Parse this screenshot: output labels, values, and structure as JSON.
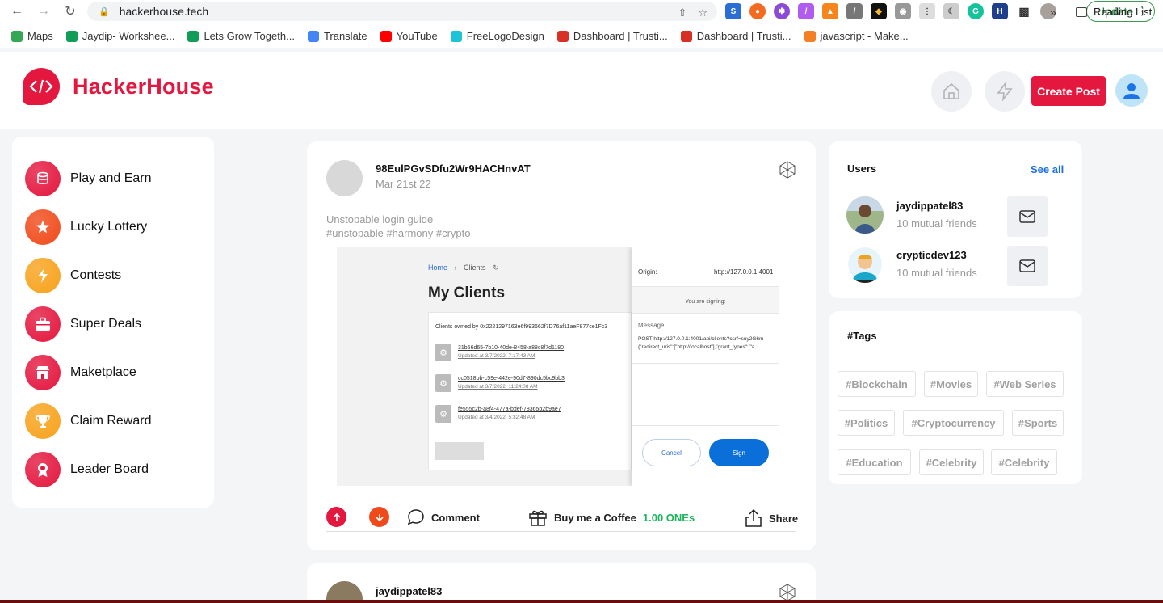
{
  "browser": {
    "url": "hackerhouse.tech",
    "update_label": "Update",
    "reading_list": "Reading List",
    "bookmarks": [
      {
        "label": "Maps",
        "color": "#34a853"
      },
      {
        "label": "Jaydip- Workshee...",
        "color": "#0f9d58"
      },
      {
        "label": "Lets Grow Togeth...",
        "color": "#0f9d58"
      },
      {
        "label": "Translate",
        "color": "#4285f4"
      },
      {
        "label": "YouTube",
        "color": "#ff0000"
      },
      {
        "label": "FreeLogoDesign",
        "color": "#1ec3d7"
      },
      {
        "label": "Dashboard | Trusti...",
        "color": "#d93025"
      },
      {
        "label": "Dashboard | Trusti...",
        "color": "#d93025"
      },
      {
        "label": "javascript - Make...",
        "color": "#f48024"
      }
    ]
  },
  "header": {
    "brand": "HackerHouse",
    "create_post": "Create Post"
  },
  "sidebar": {
    "items": [
      {
        "label": "Play and Earn",
        "icon": "coins-icon",
        "color": "#e4173f"
      },
      {
        "label": "Lucky Lottery",
        "icon": "star-icon",
        "color": "#f04a1a"
      },
      {
        "label": "Contests",
        "icon": "lightning-icon",
        "color": "#f7a21b"
      },
      {
        "label": "Super Deals",
        "icon": "briefcase-icon",
        "color": "#e4173f"
      },
      {
        "label": "Maketplace",
        "icon": "store-icon",
        "color": "#e4173f"
      },
      {
        "label": "Claim Reward",
        "icon": "trophy-icon",
        "color": "#f7a21b"
      },
      {
        "label": "Leader Board",
        "icon": "badge-icon",
        "color": "#e4173f"
      }
    ]
  },
  "post": {
    "author": "98EulPGvSDfu2Wr9HACHnvAT",
    "date": "Mar 21st 22",
    "title": "Unstopable login guide",
    "hashtags": "#unstopable #harmony #crypto",
    "comment_label": "Comment",
    "coffee_label": "Buy me a Coffee",
    "coffee_amount": "1.00 ONEs",
    "share_label": "Share",
    "screenshot": {
      "breadcrumb_home": "Home",
      "breadcrumb_clients": "Clients",
      "heading": "My Clients",
      "owned_by": "Clients owned by 0x2221297163e6f993662f7D76af11aeF877ce1Fc3",
      "clients": [
        {
          "id": "31b56d65-7b10-40de-8458-a88c8f7d1180",
          "updated": "Updated at 3/7/2022, 7:17:43 AM"
        },
        {
          "id": "cc0518bb-c59e-442e-90d7-890dc5bc9bb3",
          "updated": "Updated at 3/7/2022, 11:24:08 AM"
        },
        {
          "id": "fe555c2b-a8f4-477a-bdef-78365b2b9ae7",
          "updated": "Updated at 3/4/2022, 5:32:48 AM"
        }
      ],
      "origin_label": "Origin:",
      "origin_value": "http://127.0.0.1:4001",
      "signing": "You are signing:",
      "message_label": "Message:",
      "message_line1": "POST http://127.0.0.1:4001/api/clients?csrf=suy2G6m",
      "message_line2": "{\"redirect_uris\":[\"http://localhost\"],\"grant_types\":[\"a",
      "cancel": "Cancel",
      "sign": "Sign"
    }
  },
  "post2": {
    "author": "jaydippatel83"
  },
  "users_panel": {
    "title": "Users",
    "see_all": "See all",
    "users": [
      {
        "name": "jaydippatel83",
        "mutual": "10 mutual friends"
      },
      {
        "name": "crypticdev123",
        "mutual": "10 mutual friends"
      }
    ]
  },
  "tags_panel": {
    "title": "#Tags",
    "tags": [
      "#Blockchain",
      "#Movies",
      "#Web Series",
      "#Politics",
      "#Cryptocurrency",
      "#Sports",
      "#Education",
      "#Celebrity",
      "#Celebrity"
    ]
  }
}
